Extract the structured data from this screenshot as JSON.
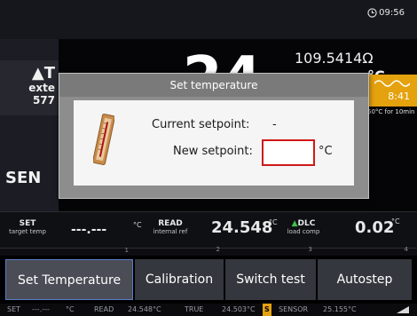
{
  "header": {
    "clock": "09:56"
  },
  "background": {
    "ext_arrow": "▲T",
    "ext_label": "exte",
    "ext_value": "577",
    "sensor_label": "SEN",
    "big_value": "24",
    "resistance": "109.5414Ω",
    "degc": "°C",
    "timer_value": "8:41",
    "timer_hint": "50°C for 10min"
  },
  "dialog": {
    "title": "Set temperature",
    "current_setpoint_label": "Current setpoint:",
    "current_setpoint_value": "-",
    "new_setpoint_label": "New setpoint:",
    "new_setpoint_value": "",
    "unit": "°C"
  },
  "readings": {
    "set_label": "SET",
    "set_sub": "target temp",
    "set_value": "---.---",
    "set_unit": "°C",
    "read_label": "READ",
    "read_sub": "internal ref",
    "read_value": "24.548",
    "read_unit": "°C",
    "dlc_label": "DLC",
    "dlc_sub": "load comp",
    "dlc_value": "0.02",
    "dlc_unit": "°C"
  },
  "softkeys": [
    {
      "label": "Set Temperature",
      "num": "1"
    },
    {
      "label": "Calibration",
      "num": "2"
    },
    {
      "label": "Switch test",
      "num": "3"
    },
    {
      "label": "Autostep",
      "num": "4"
    }
  ],
  "status": {
    "set_label": "SET",
    "set_value": "---.---",
    "set_unit": "°C",
    "read_label": "READ",
    "read_value": "24.548°C",
    "true_label": "TRUE",
    "true_value": "24.503°C",
    "badge": "S",
    "sensor_label": "SENSOR",
    "sensor_value": "25.155°C"
  },
  "colors": {
    "accent_orange": "#e5a20f",
    "input_border": "#d01818",
    "arrow_green": "#3fc24a",
    "active_key_border": "#5c7cc8"
  }
}
